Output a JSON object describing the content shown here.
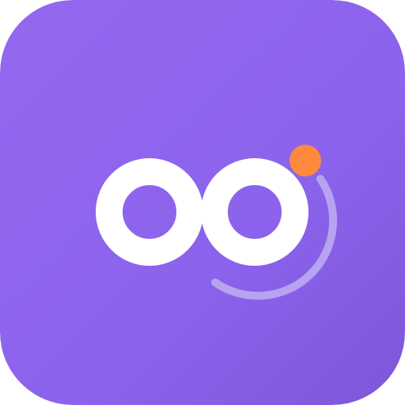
{
  "app_icon": {
    "name": "app-logo",
    "colors": {
      "background_top": "#9468EE",
      "background_bottom": "#7E56D8",
      "loops": "#FFFFFF",
      "arc": "#B7A3F0",
      "dot": "#FF8A3D"
    }
  }
}
